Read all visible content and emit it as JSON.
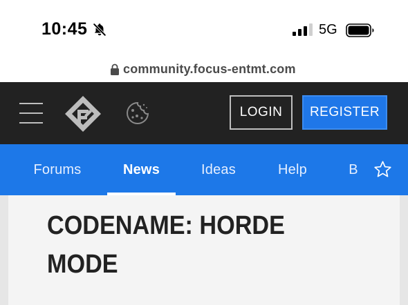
{
  "status_bar": {
    "time": "10:45",
    "network": "5G",
    "icons": [
      "bell-slash-icon",
      "signal-icon",
      "battery-icon"
    ]
  },
  "browser": {
    "url": "community.focus-entmt.com",
    "icons": [
      "lock-icon"
    ]
  },
  "header": {
    "icons": [
      "hamburger-menu-icon",
      "focus-logo-icon",
      "cookie-icon"
    ],
    "login_label": "LOGIN",
    "register_label": "REGISTER",
    "colors": {
      "background": "#222222",
      "register": "#1f77e8"
    }
  },
  "nav": {
    "items": [
      {
        "label": "Forums",
        "active": false
      },
      {
        "label": "News",
        "active": true
      },
      {
        "label": "Ideas",
        "active": false
      },
      {
        "label": "Help",
        "active": false
      },
      {
        "label": "B",
        "active": false
      }
    ],
    "icons": [
      "star-icon"
    ],
    "colors": {
      "background": "#1d78e8"
    }
  },
  "content": {
    "title": "CODENAME: HORDE MODE"
  }
}
